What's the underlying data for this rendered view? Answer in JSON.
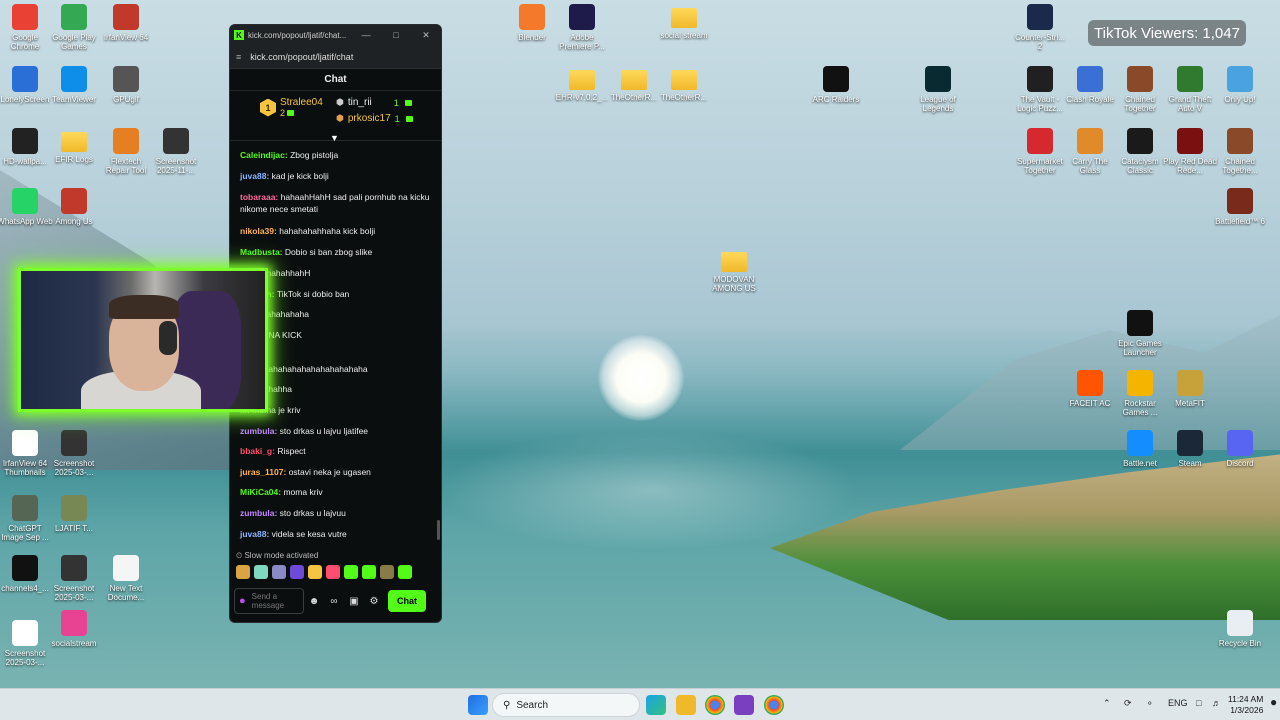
{
  "tiktok_badge": "TikTok Viewers: 1,047",
  "desktop_icons_left": [
    {
      "label": "Google Chrome",
      "icon": "chrome-icon",
      "color": "#e94235"
    },
    {
      "label": "Google Play Games",
      "icon": "play-games-icon",
      "color": "#34a853"
    },
    {
      "label": "IrfanView 64",
      "icon": "irfanview-icon",
      "color": "#c0392b"
    },
    {
      "label": "LonelyScreen",
      "icon": "lonelyscreen-icon",
      "color": "#2a6fd6"
    },
    {
      "label": "TeamViewer",
      "icon": "teamviewer-icon",
      "color": "#0e8ee9"
    },
    {
      "label": "GPUgif",
      "icon": "gpu-icon",
      "color": "#555555"
    },
    {
      "label": "HD-wallpa...",
      "icon": "wallpaper-icon",
      "color": "#222222"
    },
    {
      "label": "EFIR Logs",
      "icon": "folder-icon",
      "color": "#f0b92a"
    },
    {
      "label": "Flextech Repair Tool",
      "icon": "tool-icon",
      "color": "#e67e22"
    },
    {
      "label": "Screenshot 2025-11-...",
      "icon": "image-icon",
      "color": "#333333"
    },
    {
      "label": "WhatsApp Web",
      "icon": "whatsapp-icon",
      "color": "#25d366"
    },
    {
      "label": "Among Us",
      "icon": "amongus-icon",
      "color": "#c0392b"
    },
    {
      "label": "IrfanView 64 Thumbnails",
      "icon": "panda-icon",
      "color": "#ffffff"
    },
    {
      "label": "Screenshot 2025-03-...",
      "icon": "image-icon",
      "color": "#333333"
    },
    {
      "label": "ChatGPT Image Sep ...",
      "icon": "image-icon",
      "color": "#556655"
    },
    {
      "label": "LJATIF T...",
      "icon": "image-icon",
      "color": "#778855"
    },
    {
      "label": "channels4_...",
      "icon": "image-icon",
      "color": "#111111"
    },
    {
      "label": "Screenshot 2025-03-...",
      "icon": "image-icon",
      "color": "#333333"
    },
    {
      "label": "New Text Docume...",
      "icon": "text-file-icon",
      "color": "#f5f5f5"
    },
    {
      "label": "Screenshot 2025-03-...",
      "icon": "image-icon",
      "color": "#ffffff"
    },
    {
      "label": "socialstream",
      "icon": "socialstream-icon",
      "color": "#e84393"
    }
  ],
  "desktop_icons_middle": [
    {
      "label": "Blender",
      "icon": "blender-icon",
      "color": "#f5792a"
    },
    {
      "label": "Adobe Premiere P...",
      "icon": "premiere-icon",
      "color": "#1e1a4a"
    },
    {
      "label": "social stream",
      "icon": "folder-icon",
      "color": "#f0b92a"
    },
    {
      "label": "EHR-v7.0.2_...",
      "icon": "folder-icon",
      "color": "#f0b92a"
    },
    {
      "label": "TheOtherR...",
      "icon": "folder-icon",
      "color": "#f0b92a"
    },
    {
      "label": "TheOtherR...",
      "icon": "folder-icon",
      "color": "#f0b92a"
    },
    {
      "label": "ARC Raiders",
      "icon": "arc-raiders-icon",
      "color": "#111111"
    },
    {
      "label": "League of Legends",
      "icon": "lol-icon",
      "color": "#0a2a32"
    },
    {
      "label": "MODOVAN AMONG US",
      "icon": "folder-icon",
      "color": "#f0b92a"
    }
  ],
  "desktop_icons_right": [
    {
      "label": "Counter-Stri... 2",
      "icon": "cs2-icon",
      "color": "#1b2a4a"
    },
    {
      "label": "The Vault - Logic Puzz...",
      "icon": "vault-icon",
      "color": "#202020"
    },
    {
      "label": "Clash Royale",
      "icon": "clash-icon",
      "color": "#3a6fd6"
    },
    {
      "label": "Chained Together",
      "icon": "chained-icon",
      "color": "#8a4a2a"
    },
    {
      "label": "Grand Theft Auto V",
      "icon": "gta-icon",
      "color": "#2f7a2f"
    },
    {
      "label": "Only Up!",
      "icon": "onlyup-icon",
      "color": "#4aa3df"
    },
    {
      "label": "Supermarket Together",
      "icon": "supermarket-icon",
      "color": "#d6282f"
    },
    {
      "label": "Carry The Glass",
      "icon": "glass-icon",
      "color": "#e08a2a"
    },
    {
      "label": "Cataclysm Classic",
      "icon": "wow-icon",
      "color": "#1a1a1a"
    },
    {
      "label": "Play Red Dead Rede...",
      "icon": "rdr-icon",
      "color": "#7a1010"
    },
    {
      "label": "Chained Togethe...",
      "icon": "chained-icon",
      "color": "#8a4a2a"
    },
    {
      "label": "Battlefield™ 6",
      "icon": "battlefield-icon",
      "color": "#7a2a1a"
    },
    {
      "label": "Epic Games Launcher",
      "icon": "epic-icon",
      "color": "#111111"
    },
    {
      "label": "FACEIT AC",
      "icon": "faceit-icon",
      "color": "#ff5500"
    },
    {
      "label": "Rockstar Games ...",
      "icon": "rockstar-icon",
      "color": "#f5b400"
    },
    {
      "label": "MetaFIT",
      "icon": "metafit-icon",
      "color": "#c7a23a"
    },
    {
      "label": "Battle.net",
      "icon": "battlenet-icon",
      "color": "#148eff"
    },
    {
      "label": "Steam",
      "icon": "steam-icon",
      "color": "#1b2838"
    },
    {
      "label": "Discord",
      "icon": "discord-icon",
      "color": "#5865f2"
    },
    {
      "label": "Recycle Bin",
      "icon": "recycle-bin-icon",
      "color": "#e8eef2"
    }
  ],
  "chat_window": {
    "title": "kick.com/popout/ljatif/chat...",
    "url": "kick.com/popout/ljatif/chat",
    "header": "Chat",
    "leaderboard": [
      {
        "rank": "1",
        "name": "Stralee04",
        "count": "2"
      },
      {
        "name": "tin_rii",
        "count": "1"
      },
      {
        "name": "prkosic17",
        "count": "1"
      }
    ],
    "messages": [
      {
        "user": "Caleindijac",
        "text": "Zbog pistolja",
        "color": "#53fc18"
      },
      {
        "user": "juva88",
        "text": "kad je kick bolji",
        "color": "#8ab4ff"
      },
      {
        "user": "tobaraaa",
        "text": "hahaahHahH sad pali pornhub na kicku nikome nece smetati",
        "color": "#ff6b9a"
      },
      {
        "user": "nikola39",
        "text": "hahahahahhaha kick bolji",
        "color": "#ffb347"
      },
      {
        "user": "Madbusta",
        "text": "Dobio si ban zbog slike",
        "color": "#53fc18"
      },
      {
        "user": "...107",
        "text": "hahahhahH",
        "color": "#ffb347"
      },
      {
        "user": "...kaneh",
        "text": "TikTok si dobio ban",
        "color": "#53fc18"
      },
      {
        "user": "...a",
        "text": "haahahahaha",
        "color": "#c586ff"
      },
      {
        "user": "...",
        "text": "SVI NA KICK",
        "color": "#ffb347"
      },
      {
        "user": "...9",
        "text": "",
        "color": "#ffb347"
      },
      {
        "user": "",
        "text": "ahahahahahahahahahahahahaha",
        "color": "#ffffff"
      },
      {
        "user": "",
        "text": "hahahahahha",
        "color": "#ffffff"
      },
      {
        "user": "...",
        "text": "moma je kriv",
        "color": "#ffb347"
      },
      {
        "user": "zumbula",
        "text": "sto drkas u lajvu ljatifee",
        "color": "#c586ff"
      },
      {
        "user": "bbaki_g",
        "text": "Rispect",
        "color": "#ff4d6d"
      },
      {
        "user": "juras_1107",
        "text": "ostavi neka je ugasen",
        "color": "#ffb347"
      },
      {
        "user": "MiKiCa04",
        "text": "moma kriv",
        "color": "#53fc18"
      },
      {
        "user": "zumbula",
        "text": "sto drkas u lajvuu",
        "color": "#c586ff"
      },
      {
        "user": "juva88",
        "text": "videla se kesa vutre",
        "color": "#8ab4ff"
      }
    ],
    "slow_mode": "Slow mode activated",
    "input_placeholder": "Send a message",
    "send_label": "Chat"
  },
  "taskbar": {
    "search_label": "Search",
    "language": "ENG",
    "time": "11:24 AM",
    "date": "1/3/2026"
  }
}
